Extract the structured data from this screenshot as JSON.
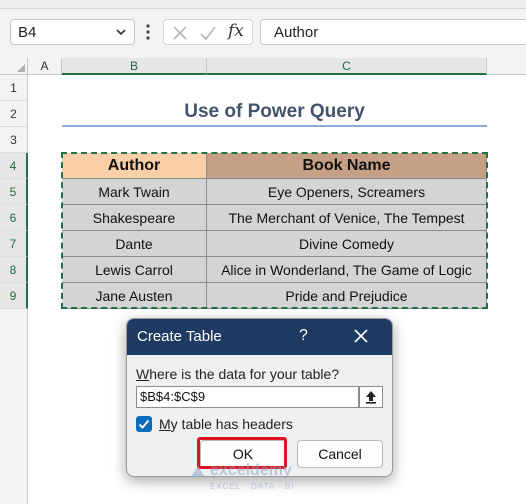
{
  "formula_bar": {
    "name_box": "B4",
    "formula": "Author",
    "fx_label": "fx"
  },
  "columns": [
    "A",
    "B",
    "C"
  ],
  "rows": [
    "1",
    "2",
    "3",
    "4",
    "5",
    "6",
    "7",
    "8",
    "9"
  ],
  "sheet": {
    "title": "Use of Power Query",
    "headers": {
      "author": "Author",
      "book": "Book Name"
    },
    "table": [
      {
        "author": "Mark Twain",
        "book": "Eye Openers, Screamers"
      },
      {
        "author": "Shakespeare",
        "book": "The Merchant of Venice, The Tempest"
      },
      {
        "author": "Dante",
        "book": "Divine Comedy"
      },
      {
        "author": "Lewis Carrol",
        "book": "Alice in Wonderland, The Game of Logic"
      },
      {
        "author": "Jane Austen",
        "book": "Pride and Prejudice"
      }
    ]
  },
  "dialog": {
    "title": "Create Table",
    "help": "?",
    "question_prefix": "W",
    "question_rest": "here is the data for your table?",
    "range": "$B$4:$C$9",
    "checkbox_prefix": "M",
    "checkbox_rest": "y table has headers",
    "checkbox_checked": true,
    "ok_label": "OK",
    "cancel_label": "Cancel"
  },
  "watermark": {
    "brand": "exceldemy",
    "sub": "EXCEL · DATA · BI"
  },
  "colors": {
    "accent": "#217346",
    "dialog_title": "#1f3b63",
    "highlight": "#e0141e",
    "author_header": "#f9cfa8",
    "book_header": "#c6a086"
  },
  "icons": [
    "chevron-down-icon",
    "kebab-icon",
    "cancel-x-icon",
    "enter-check-icon",
    "fx-icon",
    "close-icon",
    "collapse-dialog-icon",
    "checkmark-icon"
  ]
}
